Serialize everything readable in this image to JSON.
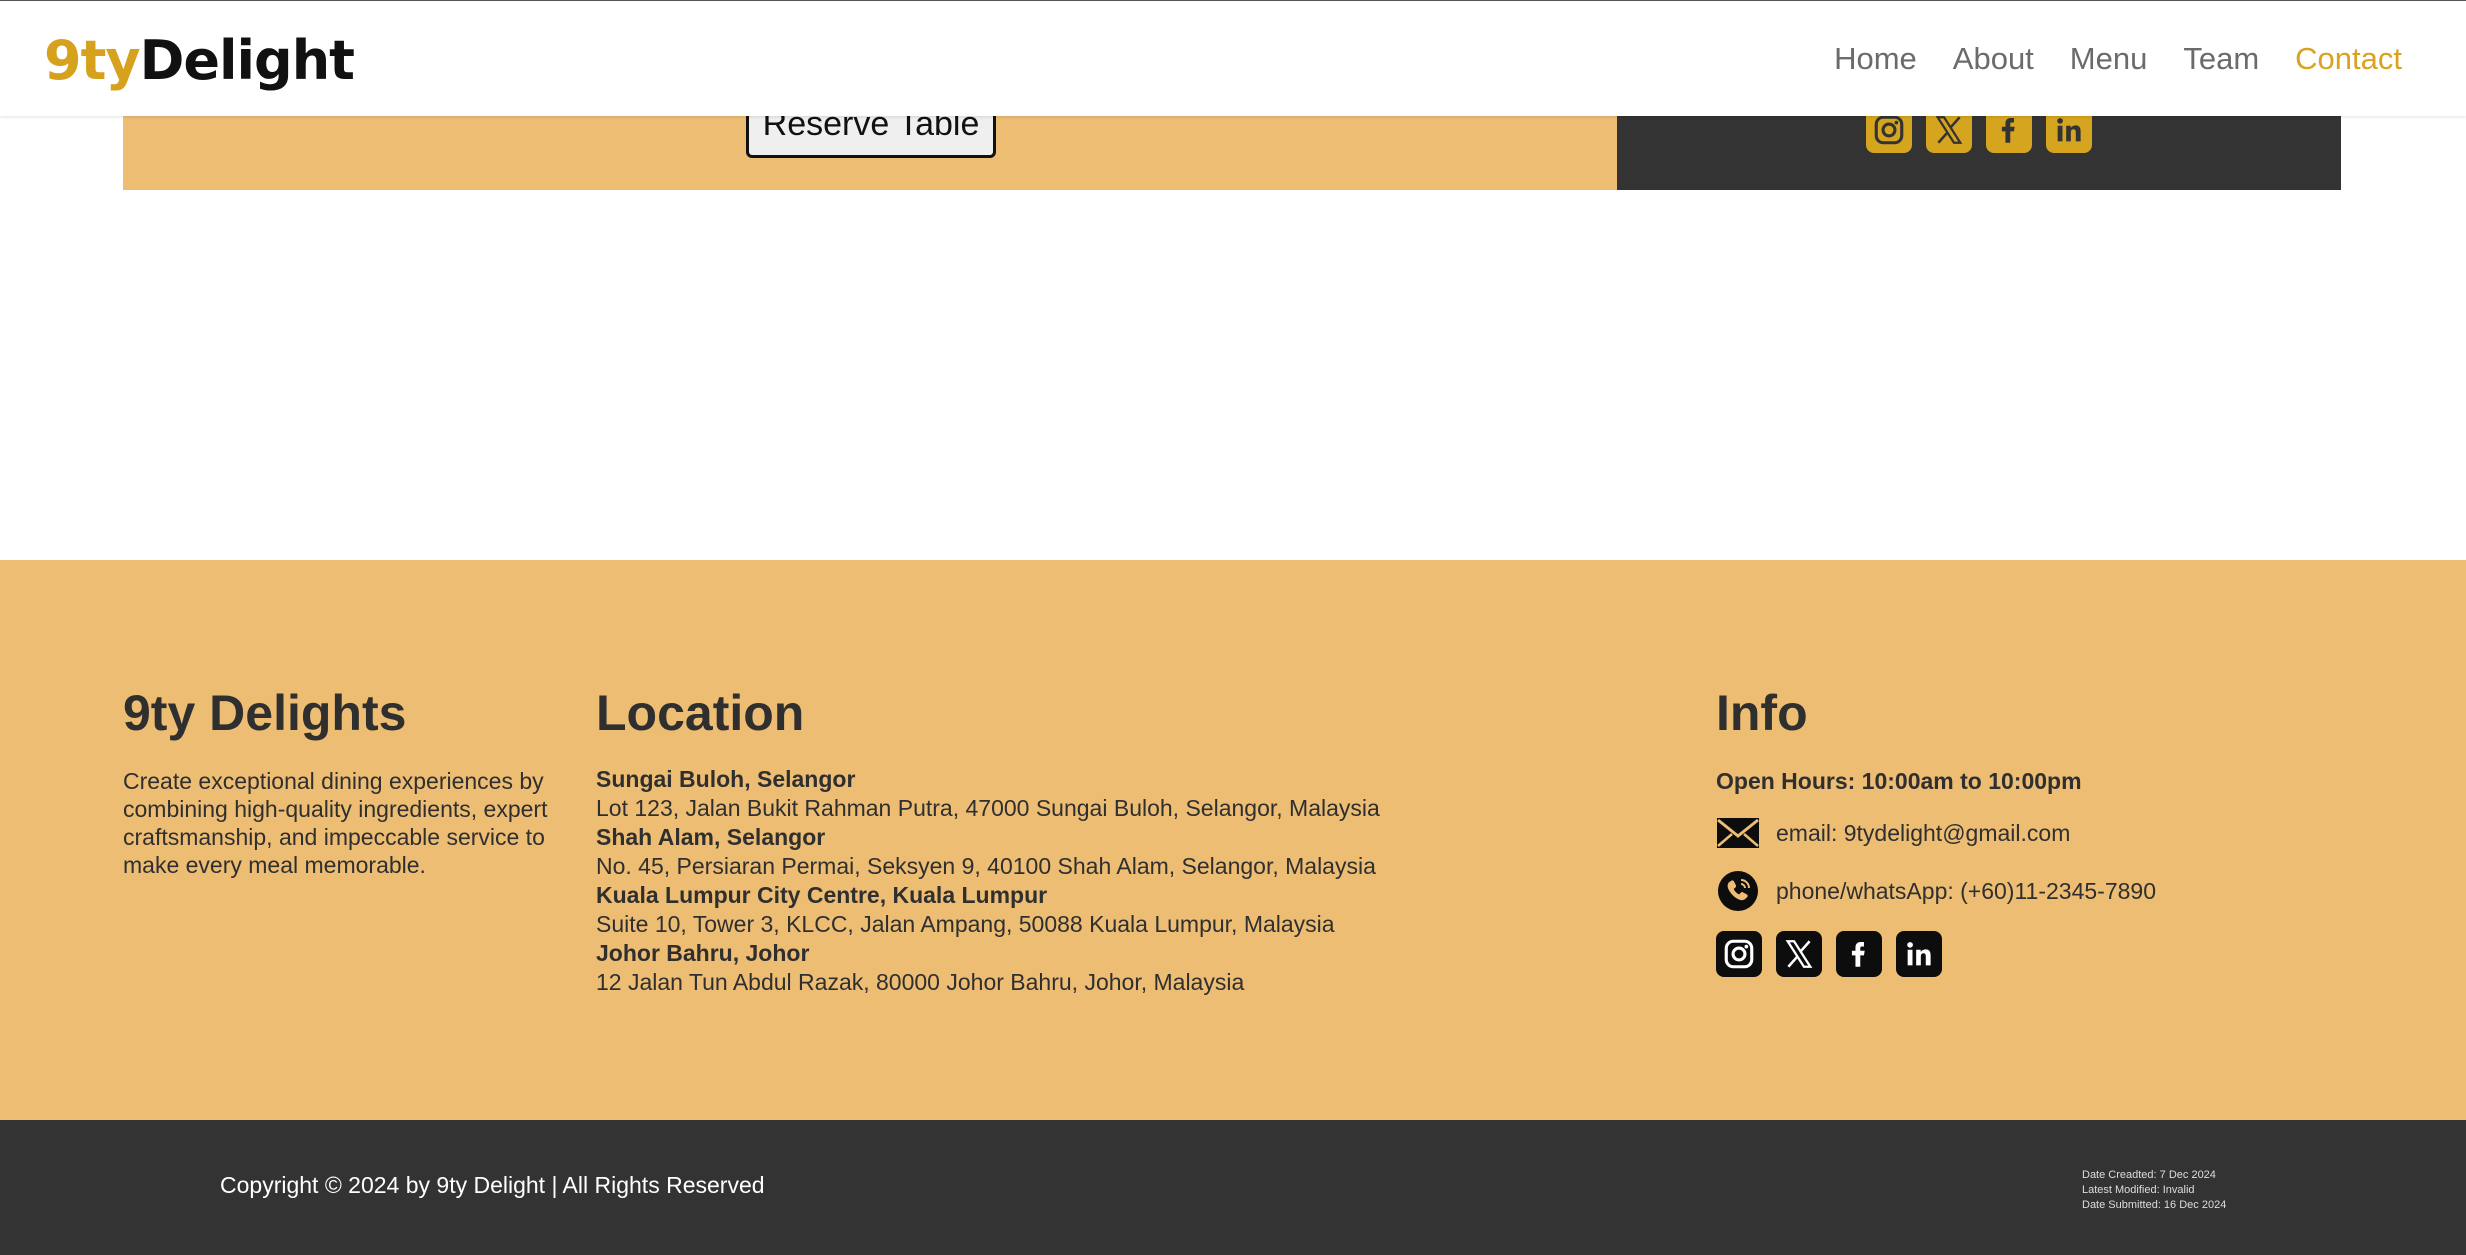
{
  "header": {
    "logo_part1": "9ty",
    "logo_part2": "Delight",
    "nav": [
      "Home",
      "About",
      "Menu",
      "Team",
      "Contact"
    ],
    "active": "Contact"
  },
  "reserve": {
    "button_label": "Reserve Table"
  },
  "colors": {
    "accent": "#d9a31f",
    "footer_bg": "#edbd74",
    "dark": "#333333"
  },
  "socials": [
    "instagram-icon",
    "x-twitter-icon",
    "facebook-icon",
    "linkedin-icon"
  ],
  "footer": {
    "about": {
      "title": "9ty Delights",
      "text": "Create exceptional dining experiences by combining high-quality ingredients, expert craftsmanship, and impeccable service to make every meal memorable."
    },
    "location": {
      "title": "Location",
      "items": [
        {
          "name": "Sungai Buloh, Selangor",
          "address": "Lot 123, Jalan Bukit Rahman Putra, 47000 Sungai Buloh, Selangor, Malaysia"
        },
        {
          "name": "Shah Alam, Selangor",
          "address": "No. 45, Persiaran Permai, Seksyen 9, 40100 Shah Alam, Selangor, Malaysia"
        },
        {
          "name": "Kuala Lumpur City Centre, Kuala Lumpur",
          "address": "Suite 10, Tower 3, KLCC, Jalan Ampang, 50088 Kuala Lumpur, Malaysia"
        },
        {
          "name": "Johor Bahru, Johor",
          "address": "12 Jalan Tun Abdul Razak, 80000 Johor Bahru, Johor, Malaysia"
        }
      ]
    },
    "info": {
      "title": "Info",
      "hours": "Open Hours: 10:00am to 10:00pm",
      "email": "email: 9tydelight@gmail.com",
      "phone": "phone/whatsApp: (+60)11-2345-7890"
    }
  },
  "bottom": {
    "copyright": "Copyright © 2024 by 9ty Delight | All Rights Reserved",
    "meta": [
      "Date Creadted: 7 Dec 2024",
      "Latest Modified: Invalid",
      "Date Submitted: 16 Dec 2024"
    ]
  }
}
